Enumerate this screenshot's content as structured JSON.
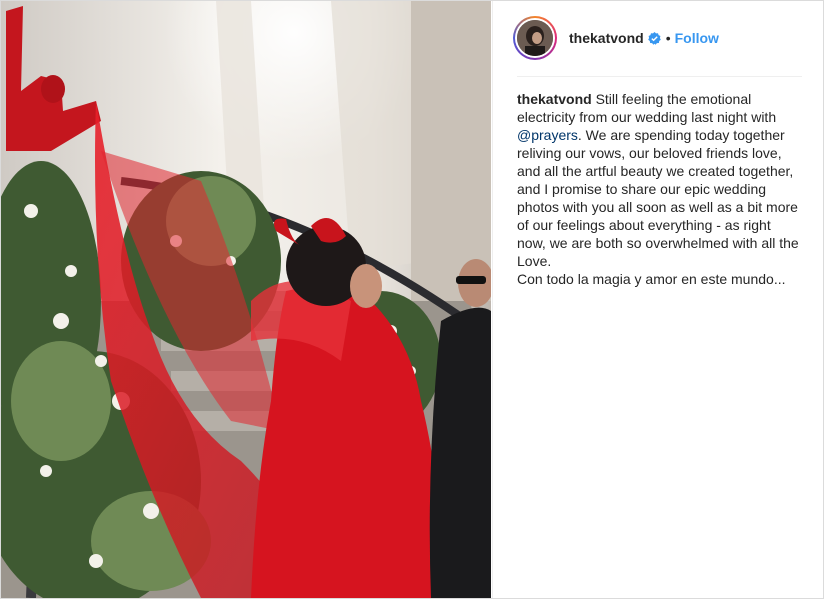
{
  "post": {
    "username": "thekatvond",
    "verified_icon": "verified-badge-icon",
    "separator": "•",
    "follow_label": "Follow",
    "colors": {
      "follow": "#3897f0",
      "mention": "#003569",
      "text": "#262626",
      "verified": "#3897f0"
    }
  },
  "caption": {
    "username": "thekatvond",
    "text_before_mention": "Still feeling the emotional electricity from our wedding last night with",
    "mention": "@prayers",
    "text_after_mention": ". We are spending today together reliving our vows, our beloved friends love, and all the artful beauty we created together, and I promise to share our epic wedding photos with you all soon as well as a bit more of our feelings about everything - as right now, we are both so overwhelmed with all the Love.",
    "last_line": "Con todo la magia y amor en este mundo..."
  }
}
